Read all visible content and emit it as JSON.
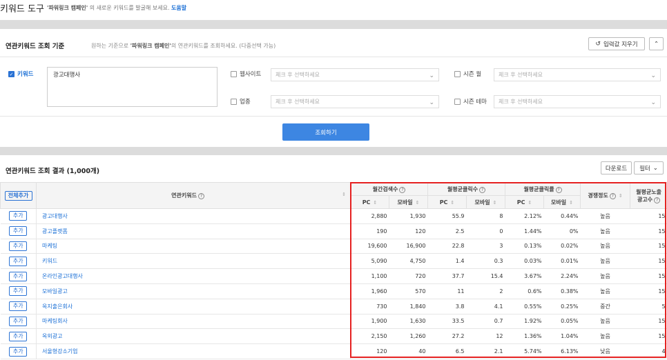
{
  "header": {
    "title": "키워드 도구",
    "desc_campaign": "'파워링크 캠페인'",
    "desc_rest": " 의 새로운 키워드를 발굴해 보세요.",
    "help": "도움말"
  },
  "query": {
    "title": "연관키워드 조회 기준",
    "desc_prefix": "원하는 기준으로 ",
    "desc_campaign": "'파워링크 캠페인'",
    "desc_suffix": "의 연관키워드를 조회하세요. (다중선택 가능)",
    "reset_label": "입력값 지우기",
    "keyword_label": "키워드",
    "keyword_value": "광고대행사",
    "website_label": "웹사이트",
    "industry_label": "업종",
    "season_month_label": "시즌 월",
    "season_theme_label": "시즌 테마",
    "select_placeholder": "체크 후 선택하세요",
    "search_button": "조회하기"
  },
  "results": {
    "title": "연관키워드 조회 결과 (1,000개)",
    "download": "다운로드",
    "filter": "필터",
    "add_all": "전체추가",
    "add": "추가",
    "columns": {
      "keyword": "연관키워드",
      "monthly_search": "월간검색수",
      "avg_clicks": "월평균클릭수",
      "avg_ctr": "월평균클릭률",
      "competition": "경쟁정도",
      "avg_ads_1": "월평균노출",
      "avg_ads_2": "광고수",
      "pc": "PC",
      "mobile": "모바일"
    },
    "rows": [
      {
        "keyword": "광고대행사",
        "search_pc": "2,880",
        "search_mo": "1,930",
        "click_pc": "55.9",
        "click_mo": "8",
        "ctr_pc": "2.12%",
        "ctr_mo": "0.44%",
        "comp": "높음",
        "ads": "15"
      },
      {
        "keyword": "광고플랫폼",
        "search_pc": "190",
        "search_mo": "120",
        "click_pc": "2.5",
        "click_mo": "0",
        "ctr_pc": "1.44%",
        "ctr_mo": "0%",
        "comp": "높음",
        "ads": "15"
      },
      {
        "keyword": "마케팅",
        "search_pc": "19,600",
        "search_mo": "16,900",
        "click_pc": "22.8",
        "click_mo": "3",
        "ctr_pc": "0.13%",
        "ctr_mo": "0.02%",
        "comp": "높음",
        "ads": "15"
      },
      {
        "keyword": "키워드",
        "search_pc": "5,090",
        "search_mo": "4,750",
        "click_pc": "1.4",
        "click_mo": "0.3",
        "ctr_pc": "0.03%",
        "ctr_mo": "0.01%",
        "comp": "높음",
        "ads": "15"
      },
      {
        "keyword": "온라인광고대행사",
        "search_pc": "1,100",
        "search_mo": "720",
        "click_pc": "37.7",
        "click_mo": "15.4",
        "ctr_pc": "3.67%",
        "ctr_mo": "2.24%",
        "comp": "높음",
        "ads": "15"
      },
      {
        "keyword": "모바일광고",
        "search_pc": "1,960",
        "search_mo": "570",
        "click_pc": "11",
        "click_mo": "2",
        "ctr_pc": "0.6%",
        "ctr_mo": "0.38%",
        "comp": "높음",
        "ads": "15"
      },
      {
        "keyword": "옥지출은회사",
        "search_pc": "730",
        "search_mo": "1,840",
        "click_pc": "3.8",
        "click_mo": "4.1",
        "ctr_pc": "0.55%",
        "ctr_mo": "0.25%",
        "comp": "중간",
        "ads": "5"
      },
      {
        "keyword": "마케팅회사",
        "search_pc": "1,900",
        "search_mo": "1,630",
        "click_pc": "33.5",
        "click_mo": "0.7",
        "ctr_pc": "1.92%",
        "ctr_mo": "0.05%",
        "comp": "높음",
        "ads": "15"
      },
      {
        "keyword": "옥외광고",
        "search_pc": "2,150",
        "search_mo": "1,260",
        "click_pc": "27.2",
        "click_mo": "12",
        "ctr_pc": "1.36%",
        "ctr_mo": "1.04%",
        "comp": "높음",
        "ads": "15"
      },
      {
        "keyword": "서울형강소기업",
        "search_pc": "120",
        "search_mo": "40",
        "click_pc": "6.5",
        "click_mo": "2.1",
        "ctr_pc": "5.74%",
        "ctr_mo": "6.13%",
        "comp": "낮음",
        "ads": "4"
      }
    ]
  }
}
